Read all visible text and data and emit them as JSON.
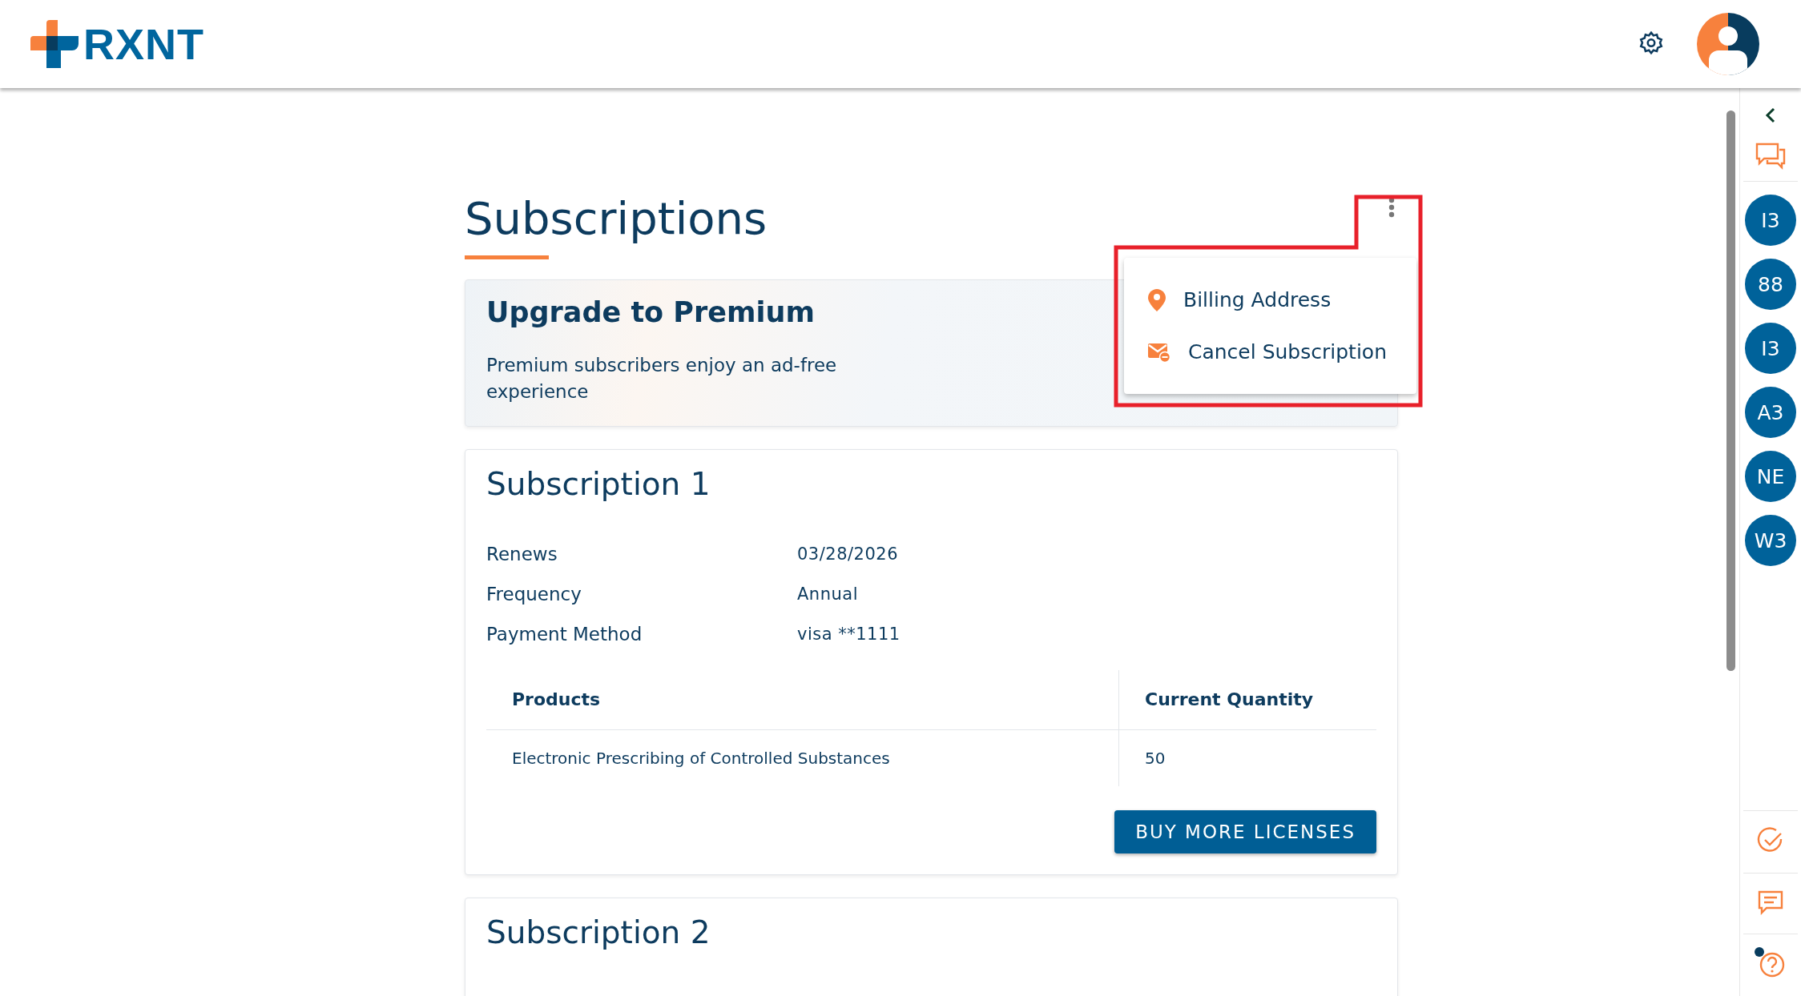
{
  "header": {
    "logo_text": "RXNT"
  },
  "page": {
    "title": "Subscriptions"
  },
  "menu": {
    "open": true,
    "items": [
      {
        "kind": "location",
        "label": "Billing Address"
      },
      {
        "kind": "cancel",
        "label": "Cancel Subscription"
      }
    ]
  },
  "premium": {
    "title": "Upgrade to Premium",
    "text": "Premium subscribers enjoy an ad-free experience"
  },
  "subscriptions": [
    {
      "title": "Subscription 1",
      "details": [
        {
          "label": "Renews",
          "value": "03/28/2026"
        },
        {
          "label": "Frequency",
          "value": "Annual"
        },
        {
          "label": "Payment Method",
          "value": "visa **1111"
        }
      ],
      "table": {
        "columns": [
          "Products",
          "Current Quantity"
        ],
        "rows": [
          [
            "Electronic Prescribing of Controlled Substances",
            "50"
          ]
        ]
      },
      "button": "BUY MORE LICENSES"
    },
    {
      "title": "Subscription 2"
    }
  ],
  "sidebar": {
    "contacts": [
      "I3",
      "88",
      "I3",
      "A3",
      "NE",
      "W3"
    ],
    "help_badge": true
  }
}
